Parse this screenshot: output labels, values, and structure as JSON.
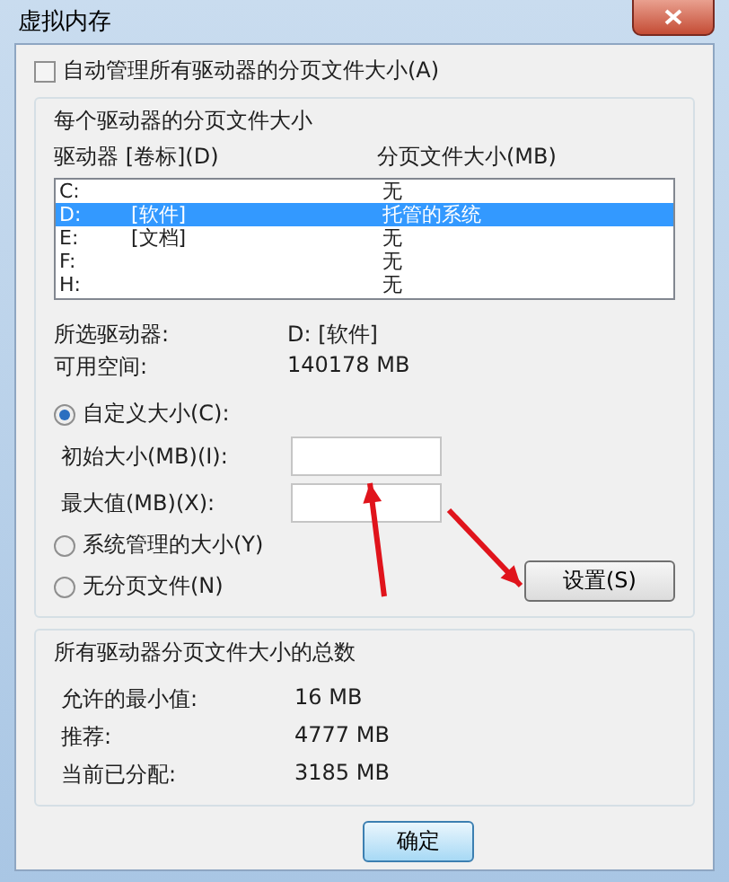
{
  "window": {
    "title": "虚拟内存"
  },
  "auto_manage": {
    "label": "自动管理所有驱动器的分页文件大小(A)",
    "checked": false
  },
  "per_drive": {
    "title": "每个驱动器的分页文件大小",
    "columns": [
      "驱动器 [卷标](D)",
      "分页文件大小(MB)"
    ],
    "rows": [
      {
        "drive": "C:",
        "size": "无",
        "selected": false
      },
      {
        "drive": "D:",
        "volume": "[软件]",
        "size": "托管的系统",
        "selected": true
      },
      {
        "drive": "E:",
        "volume": "[文档]",
        "size": "无",
        "selected": false
      },
      {
        "drive": "F:",
        "size": "无",
        "selected": false
      },
      {
        "drive": "H:",
        "size": "无",
        "selected": false
      }
    ]
  },
  "info": [
    {
      "label": "所选驱动器:",
      "value": "D:  [软件]"
    },
    {
      "label": "可用空间:",
      "value": "140178 MB"
    }
  ],
  "options": [
    {
      "label": "自定义大小(C):",
      "selected": true
    },
    {
      "label": "系统管理的大小(Y)",
      "selected": false
    },
    {
      "label": "无分页文件(N)",
      "selected": false
    }
  ],
  "fields": [
    {
      "label": "初始大小(MB)(I):"
    },
    {
      "label": "最大值(MB)(X):"
    }
  ],
  "set_button": "设置(S)",
  "totals": {
    "title": "所有驱动器分页文件大小的总数",
    "rows": [
      {
        "label": "允许的最小值:",
        "value": "16 MB"
      },
      {
        "label": "推荐:",
        "value": "4777 MB"
      },
      {
        "label": "当前已分配:",
        "value": "3185 MB"
      }
    ]
  },
  "buttons": [
    "确定"
  ]
}
